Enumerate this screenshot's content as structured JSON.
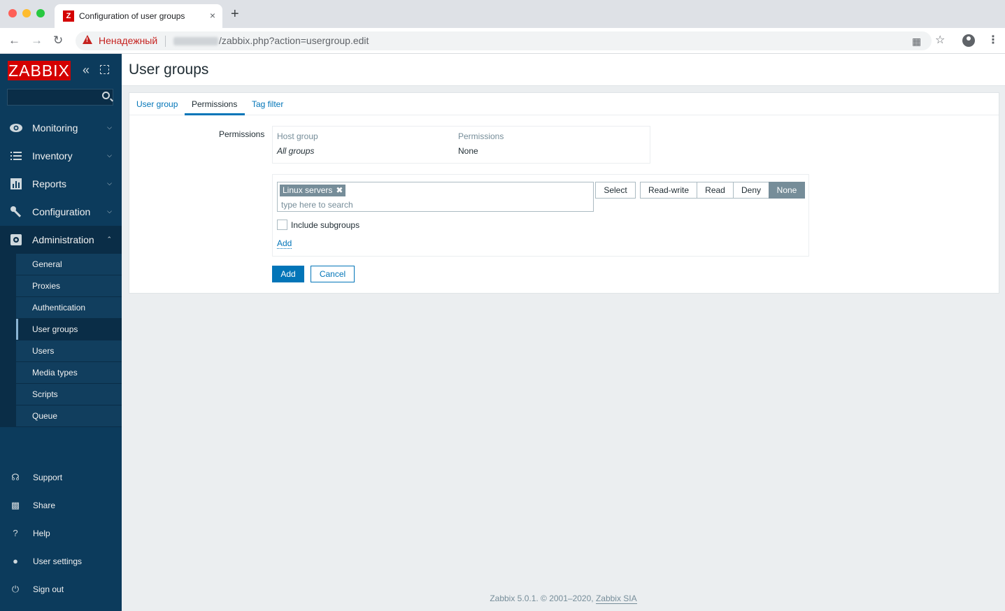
{
  "browser": {
    "tab_title": "Configuration of user groups",
    "tab_favicon": "Z",
    "tab_close": "×",
    "new_tab": "+",
    "insecure_label": "Ненадежный",
    "url_path": "/zabbix.php?action=usergroup.edit",
    "icons": [
      "back-icon",
      "forward-icon",
      "reload-icon",
      "translate-icon",
      "star-icon",
      "profile-icon",
      "menu-icon"
    ]
  },
  "sidebar": {
    "logo": "ZABBIX",
    "search_placeholder": "",
    "menu": [
      {
        "label": "Monitoring",
        "icon": "eye-icon"
      },
      {
        "label": "Inventory",
        "icon": "list-icon"
      },
      {
        "label": "Reports",
        "icon": "chart-icon"
      },
      {
        "label": "Configuration",
        "icon": "wrench-icon"
      },
      {
        "label": "Administration",
        "icon": "gear-icon"
      }
    ],
    "submenu": [
      "General",
      "Proxies",
      "Authentication",
      "User groups",
      "Users",
      "Media types",
      "Scripts",
      "Queue"
    ],
    "selected_submenu": "User groups",
    "bottom": [
      {
        "label": "Support",
        "icon": "headset-icon"
      },
      {
        "label": "Share",
        "icon": "share-icon"
      },
      {
        "label": "Help",
        "icon": "help-icon"
      },
      {
        "label": "User settings",
        "icon": "user-icon"
      },
      {
        "label": "Sign out",
        "icon": "power-icon"
      }
    ]
  },
  "page": {
    "title": "User groups",
    "tabs": [
      "User group",
      "Permissions",
      "Tag filter"
    ],
    "active_tab": "Permissions",
    "form": {
      "permissions_label": "Permissions",
      "table_headers": [
        "Host group",
        "Permissions"
      ],
      "table_rows": [
        [
          "All groups",
          "None"
        ]
      ],
      "selected_chip": "Linux servers",
      "search_placeholder": "type here to search",
      "select_button": "Select",
      "permission_options": [
        "Read-write",
        "Read",
        "Deny",
        "None"
      ],
      "selected_permission": "None",
      "include_subgroups": "Include subgroups",
      "add_link": "Add"
    },
    "buttons": {
      "add": "Add",
      "cancel": "Cancel"
    }
  },
  "footer": {
    "text": "Zabbix 5.0.1. © 2001–2020, ",
    "link": "Zabbix SIA"
  },
  "colors": {
    "sidebar": "#0c3b5c",
    "accent": "#0275b8",
    "logo": "#d40000"
  }
}
